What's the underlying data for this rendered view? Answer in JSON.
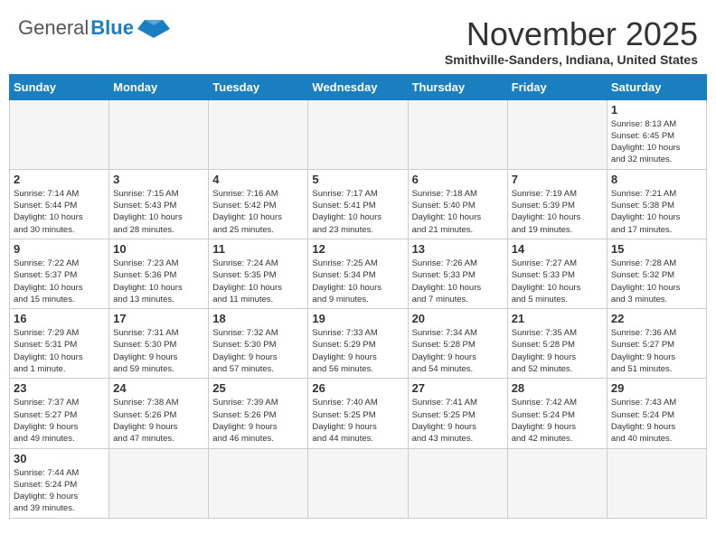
{
  "header": {
    "logo_general": "General",
    "logo_blue": "Blue",
    "title": "November 2025",
    "subtitle": "Smithville-Sanders, Indiana, United States"
  },
  "days_of_week": [
    "Sunday",
    "Monday",
    "Tuesday",
    "Wednesday",
    "Thursday",
    "Friday",
    "Saturday"
  ],
  "weeks": [
    [
      {
        "day": "",
        "info": ""
      },
      {
        "day": "",
        "info": ""
      },
      {
        "day": "",
        "info": ""
      },
      {
        "day": "",
        "info": ""
      },
      {
        "day": "",
        "info": ""
      },
      {
        "day": "",
        "info": ""
      },
      {
        "day": "1",
        "info": "Sunrise: 8:13 AM\nSunset: 6:45 PM\nDaylight: 10 hours\nand 32 minutes."
      }
    ],
    [
      {
        "day": "2",
        "info": "Sunrise: 7:14 AM\nSunset: 5:44 PM\nDaylight: 10 hours\nand 30 minutes."
      },
      {
        "day": "3",
        "info": "Sunrise: 7:15 AM\nSunset: 5:43 PM\nDaylight: 10 hours\nand 28 minutes."
      },
      {
        "day": "4",
        "info": "Sunrise: 7:16 AM\nSunset: 5:42 PM\nDaylight: 10 hours\nand 25 minutes."
      },
      {
        "day": "5",
        "info": "Sunrise: 7:17 AM\nSunset: 5:41 PM\nDaylight: 10 hours\nand 23 minutes."
      },
      {
        "day": "6",
        "info": "Sunrise: 7:18 AM\nSunset: 5:40 PM\nDaylight: 10 hours\nand 21 minutes."
      },
      {
        "day": "7",
        "info": "Sunrise: 7:19 AM\nSunset: 5:39 PM\nDaylight: 10 hours\nand 19 minutes."
      },
      {
        "day": "8",
        "info": "Sunrise: 7:21 AM\nSunset: 5:38 PM\nDaylight: 10 hours\nand 17 minutes."
      }
    ],
    [
      {
        "day": "9",
        "info": "Sunrise: 7:22 AM\nSunset: 5:37 PM\nDaylight: 10 hours\nand 15 minutes."
      },
      {
        "day": "10",
        "info": "Sunrise: 7:23 AM\nSunset: 5:36 PM\nDaylight: 10 hours\nand 13 minutes."
      },
      {
        "day": "11",
        "info": "Sunrise: 7:24 AM\nSunset: 5:35 PM\nDaylight: 10 hours\nand 11 minutes."
      },
      {
        "day": "12",
        "info": "Sunrise: 7:25 AM\nSunset: 5:34 PM\nDaylight: 10 hours\nand 9 minutes."
      },
      {
        "day": "13",
        "info": "Sunrise: 7:26 AM\nSunset: 5:33 PM\nDaylight: 10 hours\nand 7 minutes."
      },
      {
        "day": "14",
        "info": "Sunrise: 7:27 AM\nSunset: 5:33 PM\nDaylight: 10 hours\nand 5 minutes."
      },
      {
        "day": "15",
        "info": "Sunrise: 7:28 AM\nSunset: 5:32 PM\nDaylight: 10 hours\nand 3 minutes."
      }
    ],
    [
      {
        "day": "16",
        "info": "Sunrise: 7:29 AM\nSunset: 5:31 PM\nDaylight: 10 hours\nand 1 minute."
      },
      {
        "day": "17",
        "info": "Sunrise: 7:31 AM\nSunset: 5:30 PM\nDaylight: 9 hours\nand 59 minutes."
      },
      {
        "day": "18",
        "info": "Sunrise: 7:32 AM\nSunset: 5:30 PM\nDaylight: 9 hours\nand 57 minutes."
      },
      {
        "day": "19",
        "info": "Sunrise: 7:33 AM\nSunset: 5:29 PM\nDaylight: 9 hours\nand 56 minutes."
      },
      {
        "day": "20",
        "info": "Sunrise: 7:34 AM\nSunset: 5:28 PM\nDaylight: 9 hours\nand 54 minutes."
      },
      {
        "day": "21",
        "info": "Sunrise: 7:35 AM\nSunset: 5:28 PM\nDaylight: 9 hours\nand 52 minutes."
      },
      {
        "day": "22",
        "info": "Sunrise: 7:36 AM\nSunset: 5:27 PM\nDaylight: 9 hours\nand 51 minutes."
      }
    ],
    [
      {
        "day": "23",
        "info": "Sunrise: 7:37 AM\nSunset: 5:27 PM\nDaylight: 9 hours\nand 49 minutes."
      },
      {
        "day": "24",
        "info": "Sunrise: 7:38 AM\nSunset: 5:26 PM\nDaylight: 9 hours\nand 47 minutes."
      },
      {
        "day": "25",
        "info": "Sunrise: 7:39 AM\nSunset: 5:26 PM\nDaylight: 9 hours\nand 46 minutes."
      },
      {
        "day": "26",
        "info": "Sunrise: 7:40 AM\nSunset: 5:25 PM\nDaylight: 9 hours\nand 44 minutes."
      },
      {
        "day": "27",
        "info": "Sunrise: 7:41 AM\nSunset: 5:25 PM\nDaylight: 9 hours\nand 43 minutes."
      },
      {
        "day": "28",
        "info": "Sunrise: 7:42 AM\nSunset: 5:24 PM\nDaylight: 9 hours\nand 42 minutes."
      },
      {
        "day": "29",
        "info": "Sunrise: 7:43 AM\nSunset: 5:24 PM\nDaylight: 9 hours\nand 40 minutes."
      }
    ],
    [
      {
        "day": "30",
        "info": "Sunrise: 7:44 AM\nSunset: 5:24 PM\nDaylight: 9 hours\nand 39 minutes."
      },
      {
        "day": "",
        "info": ""
      },
      {
        "day": "",
        "info": ""
      },
      {
        "day": "",
        "info": ""
      },
      {
        "day": "",
        "info": ""
      },
      {
        "day": "",
        "info": ""
      },
      {
        "day": "",
        "info": ""
      }
    ]
  ]
}
